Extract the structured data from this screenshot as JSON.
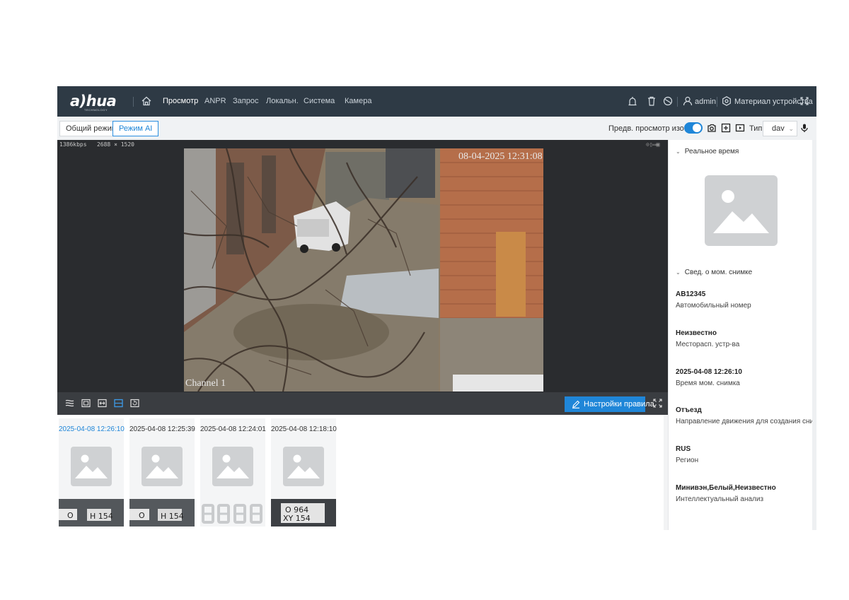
{
  "brand": {
    "logo": "a)hua",
    "sub": "TECHNOLOGY"
  },
  "nav": {
    "items": [
      {
        "label": "Просмотр",
        "active": true
      },
      {
        "label": "ANPR"
      },
      {
        "label": "Запрос"
      },
      {
        "label": "Локальн."
      },
      {
        "label": "Система"
      },
      {
        "label": "Камера"
      }
    ],
    "user": "admin",
    "device_material": "Материал устройства"
  },
  "modes": {
    "general": "Общий режим",
    "ai": "Режим AI",
    "preview_label": "Предв. просмотр изобр-я",
    "preview_enabled": true,
    "type_label": "Тип",
    "type_value": "dav"
  },
  "video": {
    "bitrate": "1386kbps",
    "resolution": "2688 × 1520",
    "osd_time": "08-04-2025 12:31:08",
    "osd_channel": "Channel 1",
    "rule_settings_label": "Настройки правила"
  },
  "snapshots": [
    {
      "time": "2025-04-08 12:26:10",
      "active": true,
      "plate": "O H 154"
    },
    {
      "time": "2025-04-08 12:25:39",
      "plate": "O H 154"
    },
    {
      "time": "2025-04-08 12:24:01",
      "plate": "8888"
    },
    {
      "time": "2025-04-08 12:18:10",
      "plate": "O 964 XY 154"
    }
  ],
  "panel": {
    "realtime_title": "Реальное время",
    "snapshot_info_title": "Свед. о мом. снимке",
    "fields": [
      {
        "value": "AB12345",
        "label": "Автомобильный номер"
      },
      {
        "value": "Неизвестно",
        "label": "Месторасп. устр-ва"
      },
      {
        "value": "2025-04-08 12:26:10",
        "label": "Время мом. снимка"
      },
      {
        "value": "Отъезд",
        "label": "Направление движения для создания снимка"
      },
      {
        "value": "RUS",
        "label": "Регион"
      },
      {
        "value": "Минивэн,Белый,Неизвестно",
        "label": "Интеллектуальный анализ"
      }
    ]
  },
  "colors": {
    "topbar": "#2e3a45",
    "accent": "#1f86d8"
  }
}
